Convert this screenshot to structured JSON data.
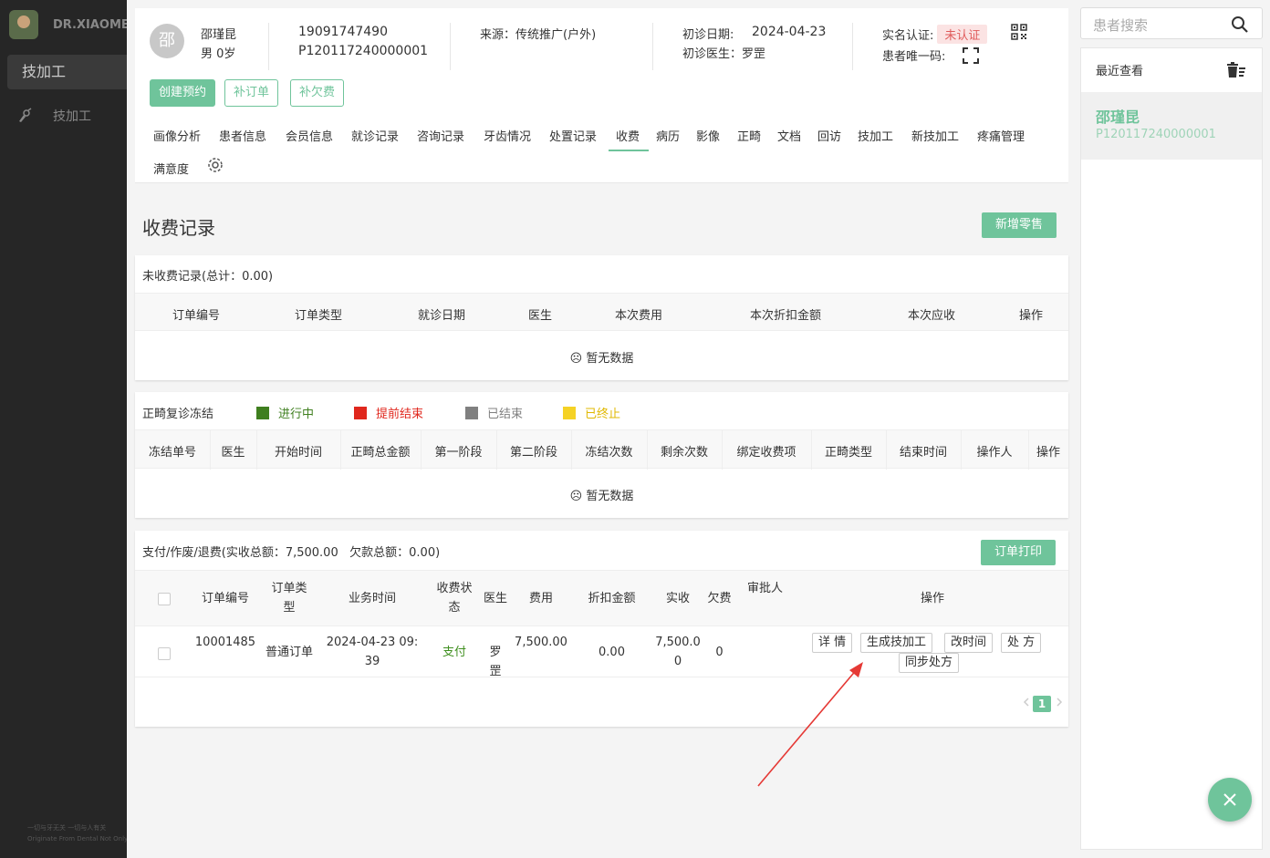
{
  "app": {
    "logo_text": "DR.XIAOMEI",
    "footer_line1": "一切与牙无关 一切与人有关",
    "footer_line2": "Originate From Dental Not Only"
  },
  "left_nav": {
    "active_label": "技加工",
    "items": [
      {
        "label": "技加工",
        "icon": "tooth-tool-icon"
      }
    ]
  },
  "patient": {
    "avatar_char": "邵",
    "name": "邵瑾昆",
    "gender_age": "男 0岁",
    "phone": "19091747490",
    "id": "P120117240000001",
    "source": "来源：传统推广(户外)",
    "first_visit_label": "初诊日期:",
    "first_visit_date": "2024-04-23",
    "first_doctor": "初诊医生：罗罡",
    "realname_label": "实名认证:",
    "realname_status": "未认证",
    "unique_code_label": "患者唯一码:"
  },
  "actions": {
    "create_appt": "创建预约",
    "supplement_order": "补订单",
    "supplement_debt": "补欠费"
  },
  "tabs": [
    "画像分析",
    "患者信息",
    "会员信息",
    "就诊记录",
    "咨询记录",
    "牙齿情况",
    "处置记录",
    "收费",
    "病历",
    "影像",
    "正畸",
    "文档",
    "回访",
    "技加工",
    "新技加工",
    "疼痛管理",
    "满意度"
  ],
  "active_tab": "收费",
  "page": {
    "title": "收费记录",
    "new_retail": "新增零售"
  },
  "unpaid": {
    "title": "未收费记录(总计：0.00)",
    "columns": [
      "订单编号",
      "订单类型",
      "就诊日期",
      "医生",
      "本次费用",
      "本次折扣金额",
      "本次应收",
      "操作"
    ],
    "empty": "暂无数据"
  },
  "freeze": {
    "title": "正畸复诊冻结",
    "legend": [
      {
        "label": "进行中",
        "color": "#3f7f1f"
      },
      {
        "label": "提前结束",
        "color": "#e0271d"
      },
      {
        "label": "已结束",
        "color": "#808080"
      },
      {
        "label": "已终止",
        "color": "#f5d225"
      }
    ],
    "columns": [
      "冻结单号",
      "医生",
      "开始时间",
      "正畸总金额",
      "第一阶段",
      "第二阶段",
      "冻结次数",
      "剩余次数",
      "绑定收费项",
      "正畸类型",
      "结束时间",
      "操作人",
      "操作"
    ],
    "empty": "暂无数据"
  },
  "payments": {
    "title": "支付/作废/退费(实收总额：7,500.00",
    "debt": "欠款总额：0.00)",
    "print": "订单打印",
    "columns": [
      "订单编号",
      "订单类型",
      "业务时间",
      "收费状态",
      "医生",
      "费用",
      "折扣金额",
      "实收",
      "欠费",
      "审批人",
      "操作"
    ],
    "rows": [
      {
        "order_no": "10001485",
        "type": "普通订单",
        "time": "2024-04-23 09:39",
        "status": "支付",
        "doctor": "罗罡",
        "fee": "7,500.00",
        "discount": "0.00",
        "paid": "7,500.00",
        "debt": "0",
        "approver": ""
      }
    ],
    "row_actions": [
      "详 情",
      "生成技加工",
      "改时间",
      "处 方",
      "同步处方"
    ],
    "page": "1"
  },
  "right": {
    "search_placeholder": "患者搜索",
    "recent_title": "最近查看",
    "recent": [
      {
        "name": "邵瑾昆",
        "id": "P120117240000001"
      }
    ]
  },
  "colors": {
    "accent": "#6fc49b",
    "annotation_arrow": "#e53935"
  }
}
